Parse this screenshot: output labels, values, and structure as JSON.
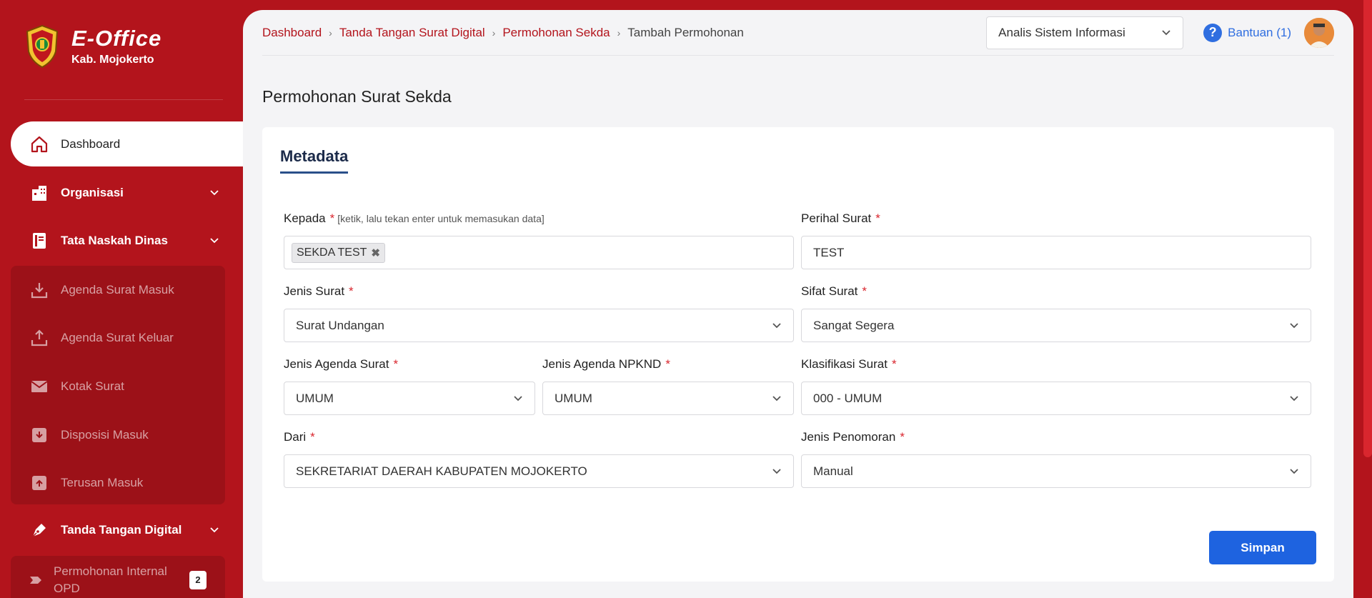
{
  "brand": {
    "title": "E-Office",
    "subtitle": "Kab. Mojokerto"
  },
  "sidebar": {
    "dashboard": "Dashboard",
    "organisasi": "Organisasi",
    "tata_naskah": "Tata Naskah Dinas",
    "tata_items": [
      {
        "label": "Agenda Surat Masuk",
        "icon": "inbox-download-icon"
      },
      {
        "label": "Agenda Surat Keluar",
        "icon": "outbox-upload-icon"
      },
      {
        "label": "Kotak Surat",
        "icon": "envelope-icon"
      },
      {
        "label": "Disposisi Masuk",
        "icon": "box-in-icon"
      },
      {
        "label": "Terusan Masuk",
        "icon": "box-up-icon"
      }
    ],
    "ttd": "Tanda Tangan Digital",
    "permohonan_internal": "Permohonan Internal OPD",
    "permohonan_badge": "2"
  },
  "breadcrumb": {
    "items": [
      "Dashboard",
      "Tanda Tangan Surat Digital",
      "Permohonan Sekda"
    ],
    "current": "Tambah Permohonan"
  },
  "header": {
    "role": "Analis Sistem Informasi",
    "help": "Bantuan (1)"
  },
  "page": {
    "title": "Permohonan Surat Sekda",
    "section": "Metadata"
  },
  "form": {
    "kepada": {
      "label": "Kepada",
      "hint": "[ketik, lalu tekan enter untuk memasukan data]",
      "tag": "SEKDA TEST"
    },
    "perihal": {
      "label": "Perihal Surat",
      "value": "TEST"
    },
    "jenis_surat": {
      "label": "Jenis Surat",
      "value": "Surat Undangan"
    },
    "sifat_surat": {
      "label": "Sifat Surat",
      "value": "Sangat Segera"
    },
    "jenis_agenda": {
      "label": "Jenis Agenda Surat",
      "value": "UMUM"
    },
    "jenis_npknd": {
      "label": "Jenis Agenda NPKND",
      "value": "UMUM"
    },
    "klasifikasi": {
      "label": "Klasifikasi Surat",
      "value": "000 - UMUM"
    },
    "dari": {
      "label": "Dari",
      "value": "SEKRETARIAT DAERAH KABUPATEN MOJOKERTO"
    },
    "penomoran": {
      "label": "Jenis Penomoran",
      "value": "Manual"
    },
    "required_mark": "*",
    "save": "Simpan"
  }
}
